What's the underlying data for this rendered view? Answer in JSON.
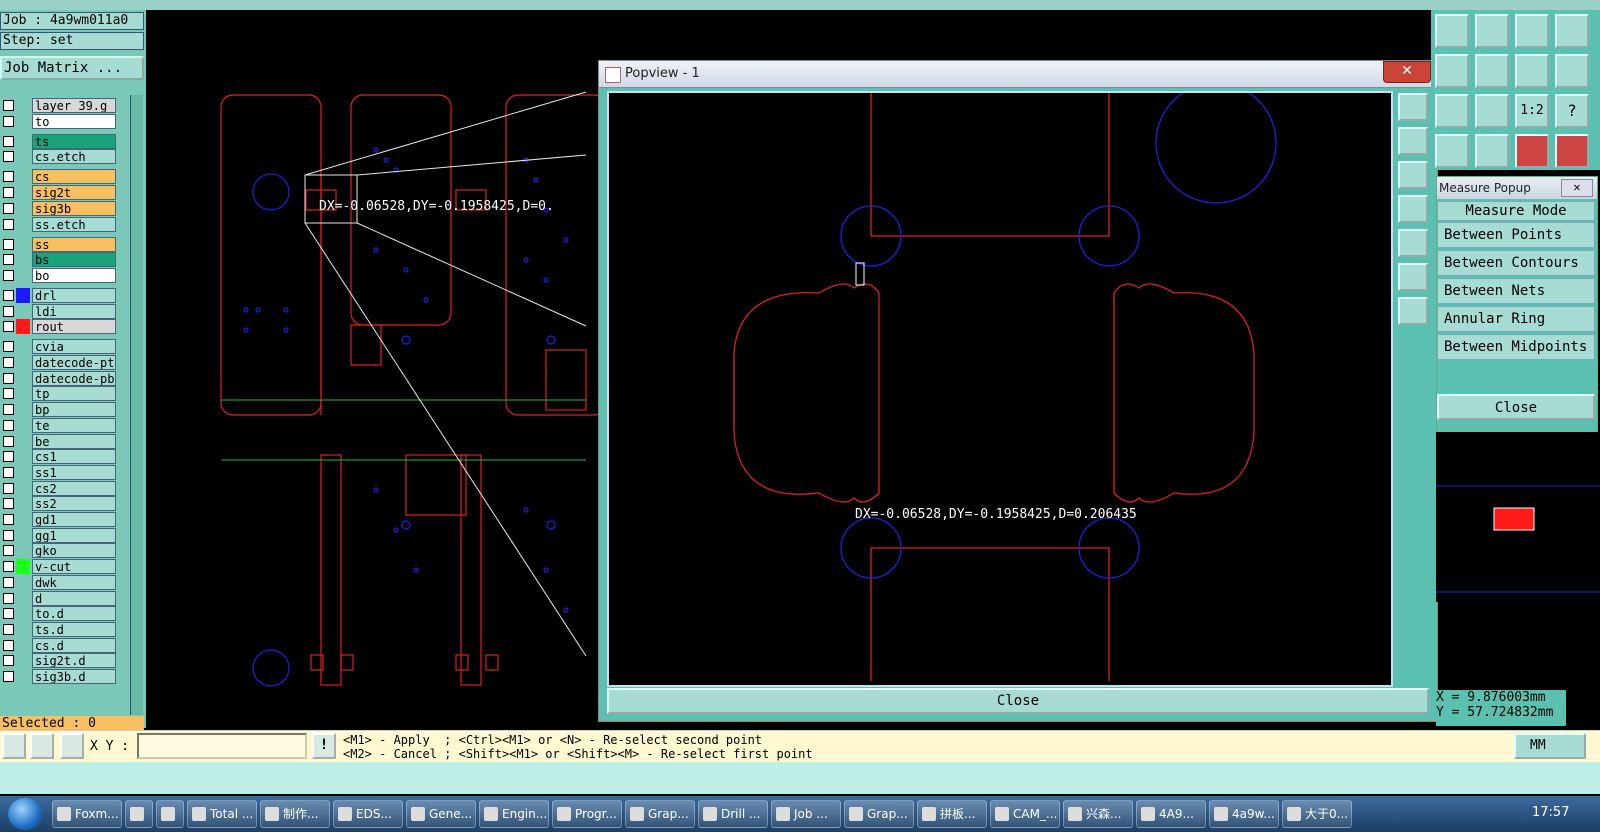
{
  "job": {
    "label": "Job : 4a9wm011a0",
    "step": "Step: set",
    "matrix_button": "Job Matrix ..."
  },
  "layers": [
    {
      "name": "layer_39.g",
      "color": "#d8d8d8",
      "swatch": ""
    },
    {
      "name": "to",
      "color": "#ffffff",
      "swatch": ""
    },
    {
      "name": "ts",
      "color": "#1aa37a",
      "swatch": ""
    },
    {
      "name": "cs.etch",
      "color": "#a6dcd4",
      "swatch": ""
    },
    {
      "name": "cs",
      "color": "#f6c060",
      "swatch": ""
    },
    {
      "name": "sig2t",
      "color": "#f6c060",
      "swatch": ""
    },
    {
      "name": "sig3b",
      "color": "#f6c060",
      "swatch": ""
    },
    {
      "name": "ss.etch",
      "color": "#a6dcd4",
      "swatch": ""
    },
    {
      "name": "ss",
      "color": "#f6c060",
      "swatch": ""
    },
    {
      "name": "bs",
      "color": "#1aa37a",
      "swatch": ""
    },
    {
      "name": "bo",
      "color": "#ffffff",
      "swatch": ""
    },
    {
      "name": "drl",
      "color": "#a6dcd4",
      "swatch": "#1a1aff"
    },
    {
      "name": "ldi",
      "color": "#a6dcd4",
      "swatch": ""
    },
    {
      "name": "rout",
      "color": "#d8d8d8",
      "swatch": "#ff1a1a"
    },
    {
      "name": "cvia",
      "color": "#a6dcd4",
      "swatch": ""
    },
    {
      "name": "datecode-ptc",
      "color": "#a6dcd4",
      "swatch": ""
    },
    {
      "name": "datecode-pbc",
      "color": "#a6dcd4",
      "swatch": ""
    },
    {
      "name": "tp",
      "color": "#a6dcd4",
      "swatch": ""
    },
    {
      "name": "bp",
      "color": "#a6dcd4",
      "swatch": ""
    },
    {
      "name": "te",
      "color": "#a6dcd4",
      "swatch": ""
    },
    {
      "name": "be",
      "color": "#a6dcd4",
      "swatch": ""
    },
    {
      "name": "cs1",
      "color": "#a6dcd4",
      "swatch": ""
    },
    {
      "name": "ss1",
      "color": "#a6dcd4",
      "swatch": ""
    },
    {
      "name": "cs2",
      "color": "#a6dcd4",
      "swatch": ""
    },
    {
      "name": "ss2",
      "color": "#a6dcd4",
      "swatch": ""
    },
    {
      "name": "gd1",
      "color": "#a6dcd4",
      "swatch": ""
    },
    {
      "name": "gg1",
      "color": "#a6dcd4",
      "swatch": ""
    },
    {
      "name": "gko",
      "color": "#a6dcd4",
      "swatch": ""
    },
    {
      "name": "v-cut",
      "color": "#a6dcd4",
      "swatch": "#1aff1a"
    },
    {
      "name": "dwk",
      "color": "#a6dcd4",
      "swatch": ""
    },
    {
      "name": "d",
      "color": "#a6dcd4",
      "swatch": ""
    },
    {
      "name": "to.d",
      "color": "#a6dcd4",
      "swatch": ""
    },
    {
      "name": "ts.d",
      "color": "#a6dcd4",
      "swatch": ""
    },
    {
      "name": "cs.d",
      "color": "#a6dcd4",
      "swatch": ""
    },
    {
      "name": "sig2t.d",
      "color": "#a6dcd4",
      "swatch": ""
    },
    {
      "name": "sig3b.d",
      "color": "#a6dcd4",
      "swatch": ""
    }
  ],
  "selected": "Selected : 0",
  "canvas_measure_text": "DX=-0.06528,DY=-0.1958425,D=0.",
  "popview": {
    "title": "Popview - 1",
    "close_x": "✕",
    "measure_text": "DX=-0.06528,DY=-0.1958425,D=0.206435",
    "close_label": "Close"
  },
  "measure_popup": {
    "title": "Measure Popup",
    "close_x": "✕",
    "mode_label": "Measure Mode",
    "modes": [
      "Between Points",
      "Between Contours",
      "Between Nets",
      "Annular Ring",
      "Between Midpoints"
    ],
    "close_label": "Close"
  },
  "right_tools": {
    "ratio_label": "1:2",
    "help_label": "?"
  },
  "coords": {
    "x": "X = 9.876003mm",
    "y": "Y = 57.724832mm"
  },
  "command_bar": {
    "xy_label": "X Y :",
    "warn": "!",
    "line1": "<M1> - Apply  ; <Ctrl><M1> or <N> - Re-select second point",
    "line2": "<M2> - Cancel ; <Shift><M1> or <Shift><M> - Re-select first point",
    "units": "MM"
  },
  "taskbar": {
    "items": [
      "Foxm...",
      "",
      "",
      "Total ...",
      "制作...",
      "EDS...",
      "Gene...",
      "Engin...",
      "Progr...",
      "Grap...",
      "Drill ...",
      "Job ...",
      "Grap...",
      "拼板...",
      "CAM_...",
      "兴森...",
      "4A9...",
      "4a9w...",
      "大于0..."
    ],
    "clock": "17:57"
  },
  "colors": {
    "panel": "#7cc8b8",
    "button": "#a6dcd4",
    "rout": "#ff1a1a",
    "drill": "#1a1aff",
    "vcut": "#1aff1a"
  }
}
